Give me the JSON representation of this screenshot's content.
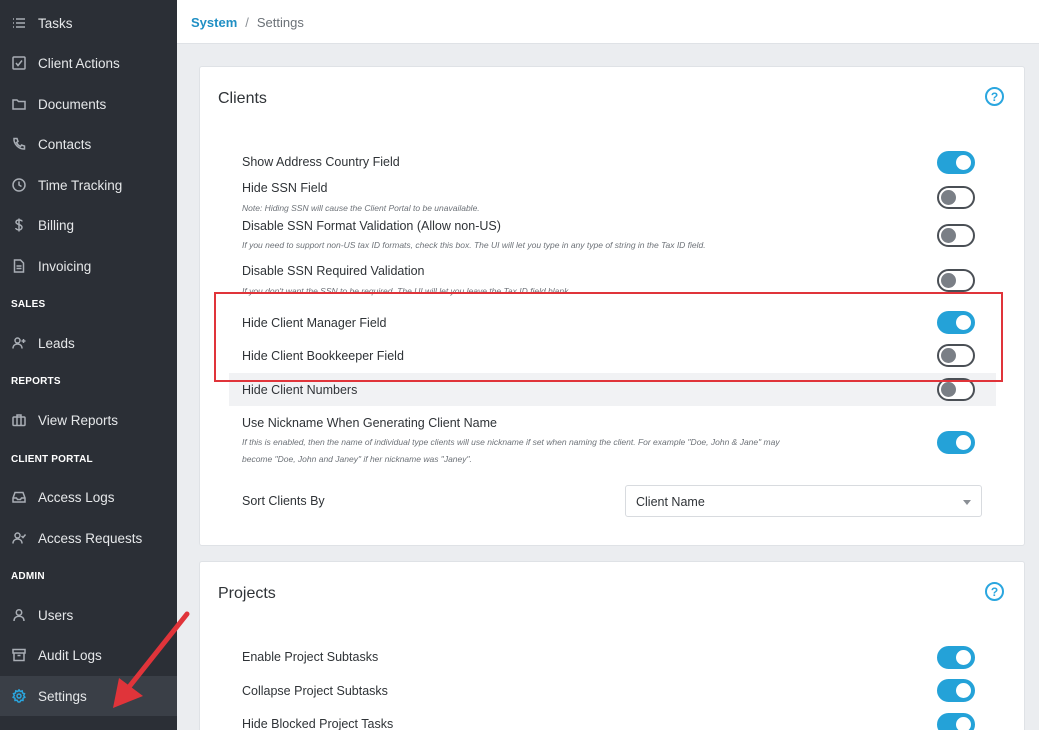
{
  "sidebar": {
    "items": [
      {
        "label": "Tasks",
        "icon": "list-icon"
      },
      {
        "label": "Client Actions",
        "icon": "checkbox-icon"
      },
      {
        "label": "Documents",
        "icon": "folder-icon"
      },
      {
        "label": "Contacts",
        "icon": "phone-icon"
      },
      {
        "label": "Time Tracking",
        "icon": "clock-icon"
      },
      {
        "label": "Billing",
        "icon": "dollar-icon"
      },
      {
        "label": "Invoicing",
        "icon": "invoice-icon"
      },
      {
        "label": "Leads",
        "icon": "user-plus-icon"
      },
      {
        "label": "View Reports",
        "icon": "briefcase-icon"
      },
      {
        "label": "Access Logs",
        "icon": "inbox-icon"
      },
      {
        "label": "Access Requests",
        "icon": "user-check-icon"
      },
      {
        "label": "Users",
        "icon": "user-icon"
      },
      {
        "label": "Audit Logs",
        "icon": "archive-icon"
      },
      {
        "label": "Settings",
        "icon": "gear-icon"
      }
    ],
    "sections": {
      "sales": "SALES",
      "reports": "REPORTS",
      "client_portal": "CLIENT PORTAL",
      "admin": "ADMIN"
    }
  },
  "breadcrumb": {
    "parent": "System",
    "separator": "/",
    "current": "Settings"
  },
  "clients": {
    "title": "Clients",
    "rows": [
      {
        "label": "Show Address Country Field",
        "on": true
      },
      {
        "label": "Hide SSN Field",
        "note": "Note: Hiding SSN will cause the Client Portal to be unavailable.",
        "on": false
      },
      {
        "label": "Disable SSN Format Validation (Allow non-US)",
        "note": "If you need to support non-US tax ID formats, check this box. The UI will let you type in any type of string in the Tax ID field.",
        "on": false
      },
      {
        "label": "Disable SSN Required Validation",
        "note": "If you don't want the SSN to be required. The UI will let you leave the Tax ID field blank.",
        "on": false
      },
      {
        "label": "Hide Client Manager Field",
        "on": true
      },
      {
        "label": "Hide Client Bookkeeper Field",
        "on": false
      },
      {
        "label": "Hide Client Numbers",
        "on": false
      },
      {
        "label": "Use Nickname When Generating Client Name",
        "note": "If this is enabled, then the name of individual type clients will use nickname if set when naming the client. For example \"Doe, John & Jane\" may become \"Doe, John and Janey\" if her nickname was \"Janey\".",
        "on": true
      }
    ],
    "sort_label": "Sort Clients By",
    "sort_value": "Client Name"
  },
  "projects": {
    "title": "Projects",
    "rows": [
      {
        "label": "Enable Project Subtasks",
        "on": true
      },
      {
        "label": "Collapse Project Subtasks",
        "on": true
      },
      {
        "label": "Hide Blocked Project Tasks",
        "on": true
      }
    ]
  },
  "colors": {
    "sidebar_bg": "#2b2f36",
    "accent": "#24a2d8",
    "annotation": "#e0343a"
  }
}
